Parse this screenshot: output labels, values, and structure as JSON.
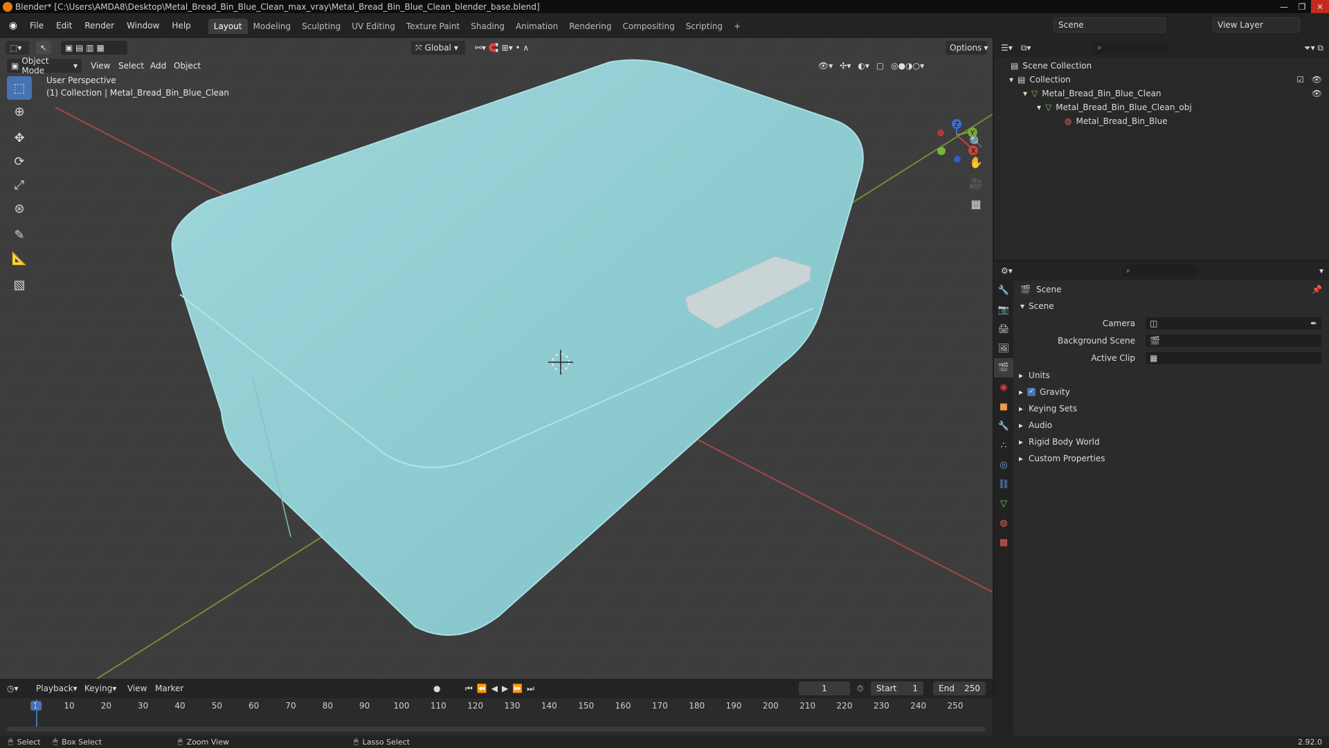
{
  "titlebar": {
    "title": "Blender* [C:\\Users\\AMDA8\\Desktop\\Metal_Bread_Bin_Blue_Clean_max_vray\\Metal_Bread_Bin_Blue_Clean_blender_base.blend]",
    "min": "—",
    "max": "❐",
    "close": "✕"
  },
  "menu": {
    "items": [
      "File",
      "Edit",
      "Render",
      "Window",
      "Help"
    ],
    "workspaces": [
      "Layout",
      "Modeling",
      "Sculpting",
      "UV Editing",
      "Texture Paint",
      "Shading",
      "Animation",
      "Rendering",
      "Compositing",
      "Scripting"
    ],
    "add_ws": "+",
    "scene": "Scene",
    "view_layer": "View Layer"
  },
  "viewport": {
    "mode": "Object Mode",
    "menus": [
      "View",
      "Select",
      "Add",
      "Object"
    ],
    "transform": "Global",
    "options": "Options",
    "perspective": "User Perspective",
    "collection_info": "(1) Collection | Metal_Bread_Bin_Blue_Clean",
    "gizmo": {
      "z": "Z",
      "y": "Y",
      "x": "X"
    }
  },
  "timeline": {
    "menus": [
      "Playback",
      "Keying",
      "View",
      "Marker"
    ],
    "current_frame": "1",
    "start_label": "Start",
    "start": "1",
    "end_label": "End",
    "end": "250",
    "ticks": [
      "1",
      "10",
      "20",
      "30",
      "40",
      "50",
      "60",
      "70",
      "80",
      "90",
      "100",
      "110",
      "120",
      "130",
      "140",
      "150",
      "160",
      "170",
      "180",
      "190",
      "200",
      "210",
      "220",
      "230",
      "240",
      "250"
    ]
  },
  "status": {
    "select": "Select",
    "box_select": "Box Select",
    "zoom_view": "Zoom View",
    "lasso_select": "Lasso Select",
    "version": "2.92.0"
  },
  "outliner": {
    "root": "Scene Collection",
    "collection": "Collection",
    "object": "Metal_Bread_Bin_Blue_Clean",
    "mesh": "Metal_Bread_Bin_Blue_Clean_obj",
    "material": "Metal_Bread_Bin_Blue"
  },
  "properties": {
    "context": "Scene",
    "panel": "Scene",
    "camera_label": "Camera",
    "bg_scene_label": "Background Scene",
    "active_clip_label": "Active Clip",
    "sections": [
      "Units",
      "Gravity",
      "Keying Sets",
      "Audio",
      "Rigid Body World",
      "Custom Properties"
    ]
  },
  "colors": {
    "accent": "#4772b3",
    "object": "#8ecfd4",
    "x_axis": "#c8443f",
    "y_axis": "#7aa632"
  }
}
